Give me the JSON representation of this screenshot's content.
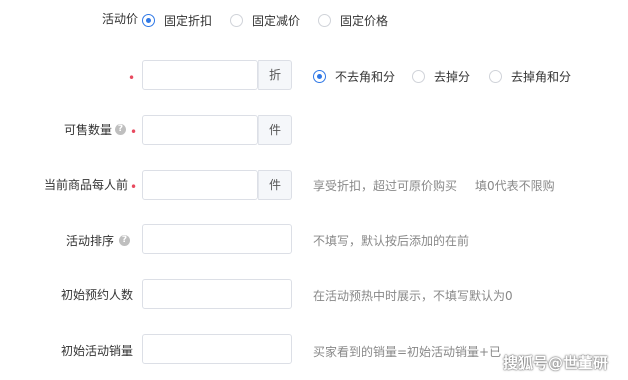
{
  "activity_price": {
    "label": "活动价",
    "options": [
      "固定折扣",
      "固定减价",
      "固定价格"
    ],
    "selected_index": 0
  },
  "discount": {
    "suffix": "折",
    "rounding_options": [
      "不去角和分",
      "去掉分",
      "去掉角和分"
    ],
    "selected_index": 0
  },
  "sellable_qty": {
    "label": "可售数量",
    "suffix": "件"
  },
  "per_person_limit": {
    "label": "当前商品每人前",
    "suffix": "件",
    "hint1": "享受折扣，超过可原价购买",
    "hint2": "填0代表不限购"
  },
  "activity_sort": {
    "label": "活动排序",
    "hint": "不填写，默认按后添加的在前"
  },
  "initial_reservations": {
    "label": "初始预约人数",
    "hint": "在活动预热中时展示，不填写默认为0"
  },
  "initial_sales": {
    "label": "初始活动销量",
    "hint": "买家看到的销量=初始活动销量+已"
  },
  "watermark": "搜狐号@世董研"
}
